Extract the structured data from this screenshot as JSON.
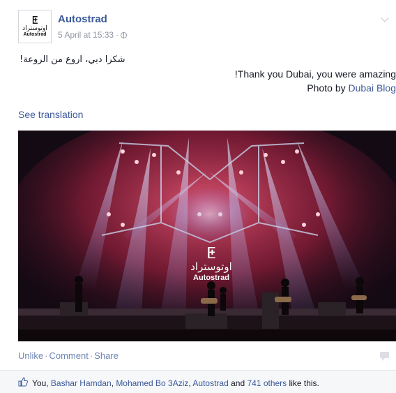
{
  "header": {
    "avatar_glyph": "ⵟ",
    "avatar_arabic": "اوتوستراد",
    "avatar_latin": "Autostrad",
    "page_name": "Autostrad",
    "timestamp": "5 April at 15:33",
    "separator": "·"
  },
  "post": {
    "line_arabic": "شكرا دبي، اروع من الروعة!",
    "line_english": "!Thank you Dubai, you were amazing",
    "photo_by_prefix": "Photo by ",
    "photo_by_link": "Dubai Blog",
    "see_translation": "See translation"
  },
  "photo": {
    "stage_logo_arabic": "اوتوستراد",
    "stage_logo_latin": "Autostrad"
  },
  "actions": {
    "unlike": "Unlike",
    "comment": "Comment",
    "share": "Share",
    "separator": "·"
  },
  "likes": {
    "you": "You, ",
    "person1": "Bashar Hamdan",
    "comma1": ", ",
    "person2": "Mohamed Bo 3Aziz",
    "comma2": ", ",
    "person3": "Autostrad",
    "and": " and ",
    "others": "741 others",
    "suffix": " like this."
  },
  "colors": {
    "link": "#3b5998",
    "meta": "#9197a3",
    "stage_red": "#e8304a",
    "stage_blue": "#5a6fd6"
  }
}
